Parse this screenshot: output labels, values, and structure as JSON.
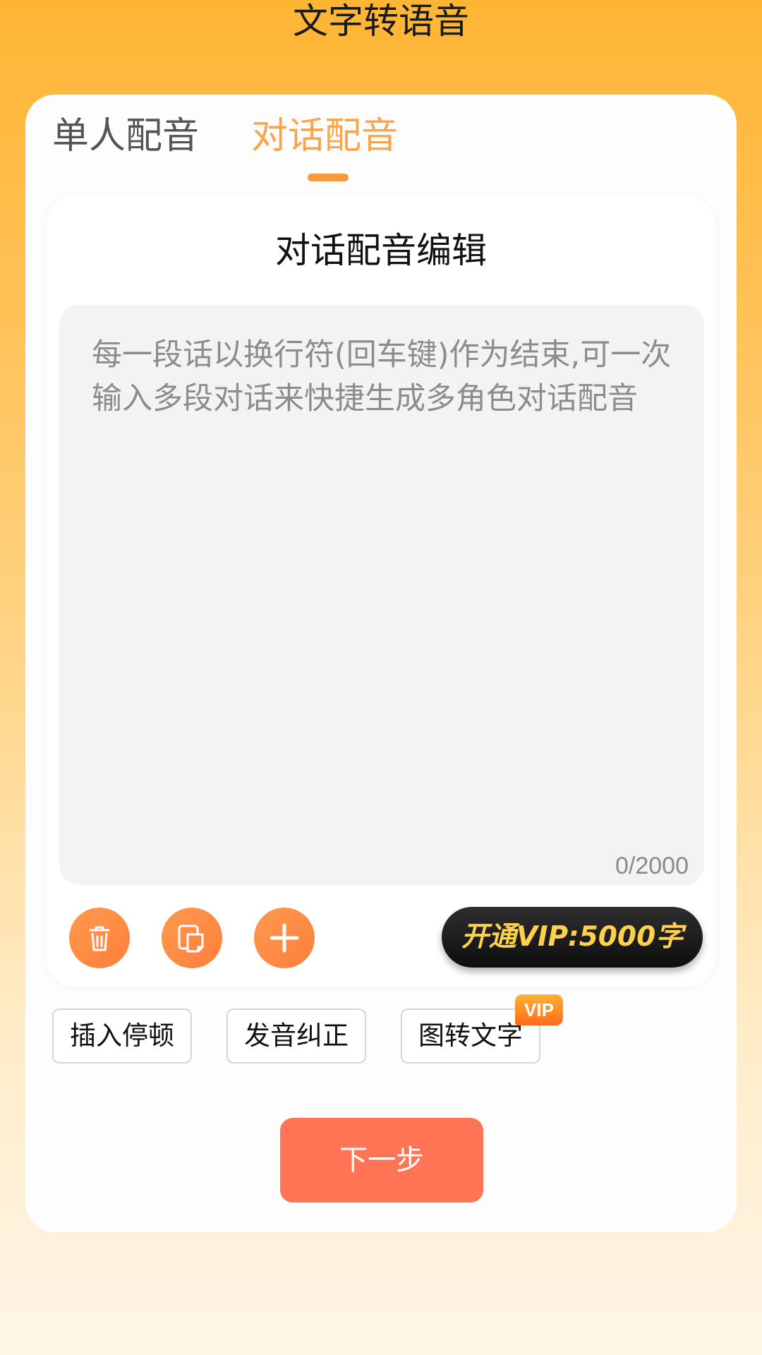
{
  "header": {
    "title": "文字转语音"
  },
  "tabs": {
    "single": "单人配音",
    "dialog": "对话配音",
    "active": "dialog"
  },
  "editor": {
    "title": "对话配音编辑",
    "placeholder": "每一段话以换行符(回车键)作为结束,可一次输入多段对话来快捷生成多角色对话配音",
    "value": "",
    "counter": "0/2000"
  },
  "actions": {
    "delete_icon": "trash-icon",
    "copy_icon": "copy-icon",
    "add_icon": "plus-icon",
    "vip_label": "开通VIP:5000字"
  },
  "tools": {
    "insert_pause": "插入停顿",
    "pronunciation_fix": "发音纠正",
    "image_to_text": "图转文字",
    "vip_badge": "VIP"
  },
  "footer": {
    "next_label": "下一步"
  },
  "colors": {
    "accent_orange": "#F8A64C",
    "next_button": "#FF7455",
    "vip_text": "#FFD04A"
  }
}
